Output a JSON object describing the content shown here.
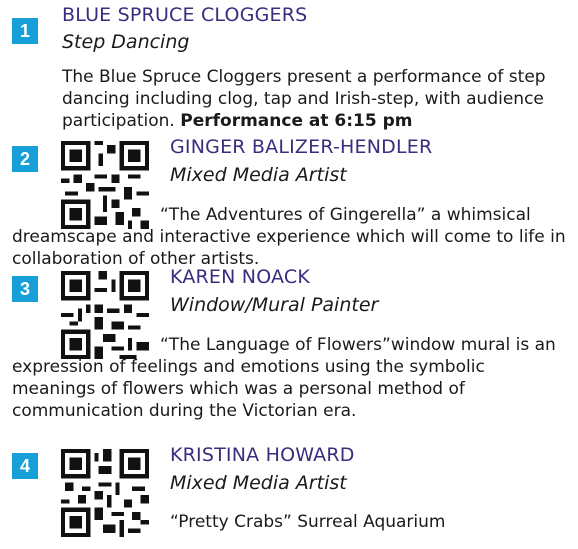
{
  "entries": [
    {
      "number": "1",
      "name": "BLUE SPRUCE CLOGGERS",
      "role": "Step Dancing",
      "description": "The Blue Spruce Cloggers present a performance of step dancing including clog, tap and Irish-step, with audience participation.",
      "highlight": "Performance at 6:15 pm"
    },
    {
      "number": "2",
      "name": "GINGER BALIZER-HENDLER",
      "role": "Mixed Media Artist",
      "description": "“The Adventures of Gingerella” a whimsical dreamscape and interactive experience which will come to life in collaboration of other artists."
    },
    {
      "number": "3",
      "name": "KAREN NOACK",
      "role": "Window/Mural Painter",
      "description": "“The Language of Flowers”window mural is an expression of feelings and emotions using the symbolic meanings of flowers which was a personal method of communication during the Victorian era."
    },
    {
      "number": "4",
      "name": "KRISTINA HOWARD",
      "role": "Mixed Media Artist",
      "description": "“Pretty Crabs” Surreal Aquarium"
    }
  ],
  "colors": {
    "badge": "#17a0d8",
    "name": "#3a2d7d",
    "text": "#1a1a1a"
  }
}
